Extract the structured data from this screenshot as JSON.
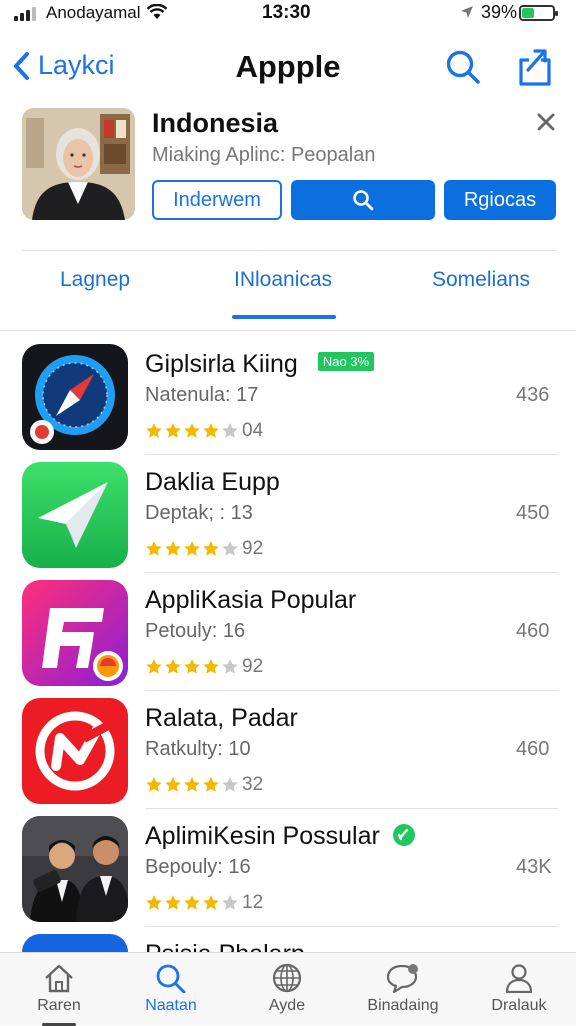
{
  "status_bar": {
    "carrier": "Anodayamal",
    "time": "13:30",
    "battery": "39%",
    "battery_level": 0.39
  },
  "nav": {
    "back_label": "Laykci",
    "title": "Appple"
  },
  "profile": {
    "name": "Indonesia",
    "subtitle": "Miaking Aplinc: Peopalan",
    "btn_outline": "Inderwem",
    "btn_right": "Rgiocas"
  },
  "tabs": [
    {
      "label": "Lagnep"
    },
    {
      "label": "INloanicas"
    },
    {
      "label": "Somelians"
    }
  ],
  "apps": [
    {
      "name": "Giplsirla Kiing",
      "badge": "Nao 3%",
      "meta": "Natenula:  17",
      "stars": 4,
      "rating_count": "04",
      "number": "436",
      "icon": "compass-icon"
    },
    {
      "name": "Daklia Eupp",
      "meta": "Deptak; :  13",
      "stars": 4,
      "rating_count": "92",
      "number": "450",
      "icon": "paper-plane-icon"
    },
    {
      "name": "AppliKasia Popular",
      "meta": "Petouly:  16",
      "stars": 4,
      "rating_count": "92",
      "number": "460",
      "icon": "f-letter-icon"
    },
    {
      "name": "Ralata, Padar",
      "meta": "Ratkulty:  10",
      "stars": 4,
      "rating_count": "32",
      "number": "460",
      "icon": "n-check-icon"
    },
    {
      "name": "AplimiKesin Possular",
      "meta": "Bepouly:  16",
      "stars": 4,
      "rating_count": "12",
      "number": "43K",
      "icon": "photo-icon"
    },
    {
      "name": "Psisia Phalarp",
      "icon": "blue-app-icon"
    }
  ],
  "tabbar": [
    {
      "label": "Raren",
      "icon": "home-icon"
    },
    {
      "label": "Naatan",
      "icon": "search-icon"
    },
    {
      "label": "Ayde",
      "icon": "globe-icon"
    },
    {
      "label": "Binadaing",
      "icon": "chat-icon"
    },
    {
      "label": "Dralauk",
      "icon": "person-icon"
    }
  ],
  "colors": {
    "accent": "#1a73e8",
    "badge": "#22c55e",
    "star": "#f5b800"
  }
}
